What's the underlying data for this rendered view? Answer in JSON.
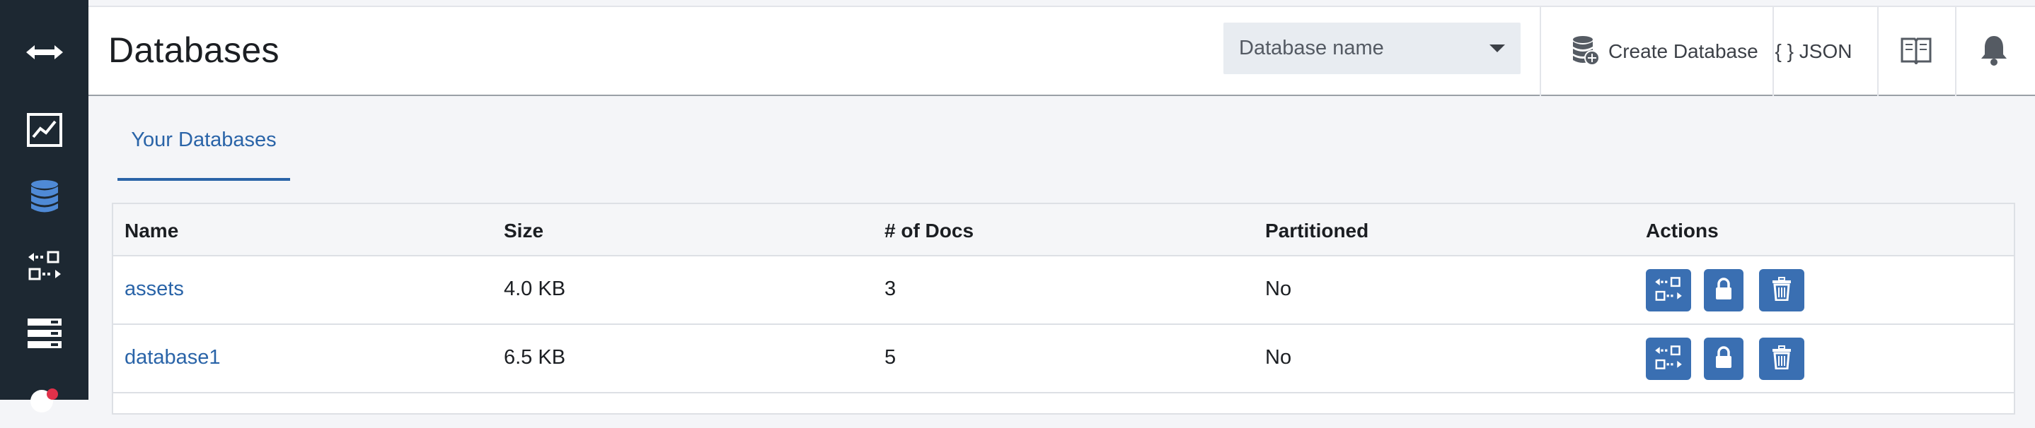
{
  "sidebar": {
    "items": [
      {
        "icon": "double-arrow-icon"
      },
      {
        "icon": "activity-chart-icon"
      },
      {
        "icon": "database-icon"
      },
      {
        "icon": "replication-icon"
      },
      {
        "icon": "server-list-icon"
      },
      {
        "icon": "user-avatar-icon"
      }
    ]
  },
  "header": {
    "title": "Databases",
    "search": {
      "placeholder": "Database name"
    },
    "create_database_label": "Create Database",
    "json_label": "{ } JSON"
  },
  "tabs": [
    {
      "label": "Your Databases"
    }
  ],
  "table": {
    "columns": [
      "Name",
      "Size",
      "# of Docs",
      "Partitioned",
      "Actions"
    ],
    "rows": [
      {
        "name": "assets",
        "size": "4.0 KB",
        "docs": "3",
        "partitioned": "No"
      },
      {
        "name": "database1",
        "size": "6.5 KB",
        "docs": "5",
        "partitioned": "No"
      }
    ]
  },
  "colors": {
    "sidebar_bg": "#1d2832",
    "accent": "#2a64a8",
    "action_button": "#3a6fb2"
  }
}
